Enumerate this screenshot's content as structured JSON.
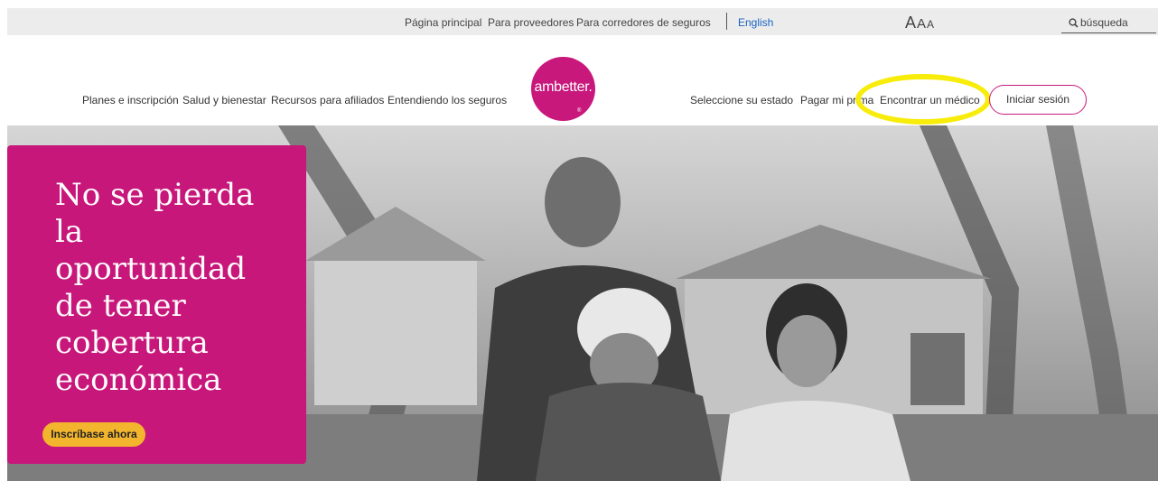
{
  "utility_bar": {
    "links": [
      "Página principal",
      "Para proveedores",
      "Para corredores de seguros"
    ],
    "language": "English",
    "text_size": [
      "A",
      "A",
      "A"
    ],
    "search_placeholder": "búsqueda"
  },
  "header": {
    "left_nav": [
      "Planes e inscripción",
      "Salud y bienestar",
      "Recursos para afiliados",
      "Entendiendo los seguros"
    ],
    "logo": {
      "text": "ambetter.",
      "reg": "®"
    },
    "right_nav": [
      "Seleccione su estado",
      "Pagar mi prima",
      "Encontrar un médico"
    ],
    "login_label": "Iniciar sesión"
  },
  "hero": {
    "heading": "No se pierda la oportunidad de tener cobertura económica",
    "cta_label": "Inscríbase ahora"
  },
  "colors": {
    "brand_magenta": "#c8187c",
    "cta_yellow": "#f3b52d",
    "highlight_yellow": "#f7ec0a",
    "link_blue": "#1a63c2"
  }
}
